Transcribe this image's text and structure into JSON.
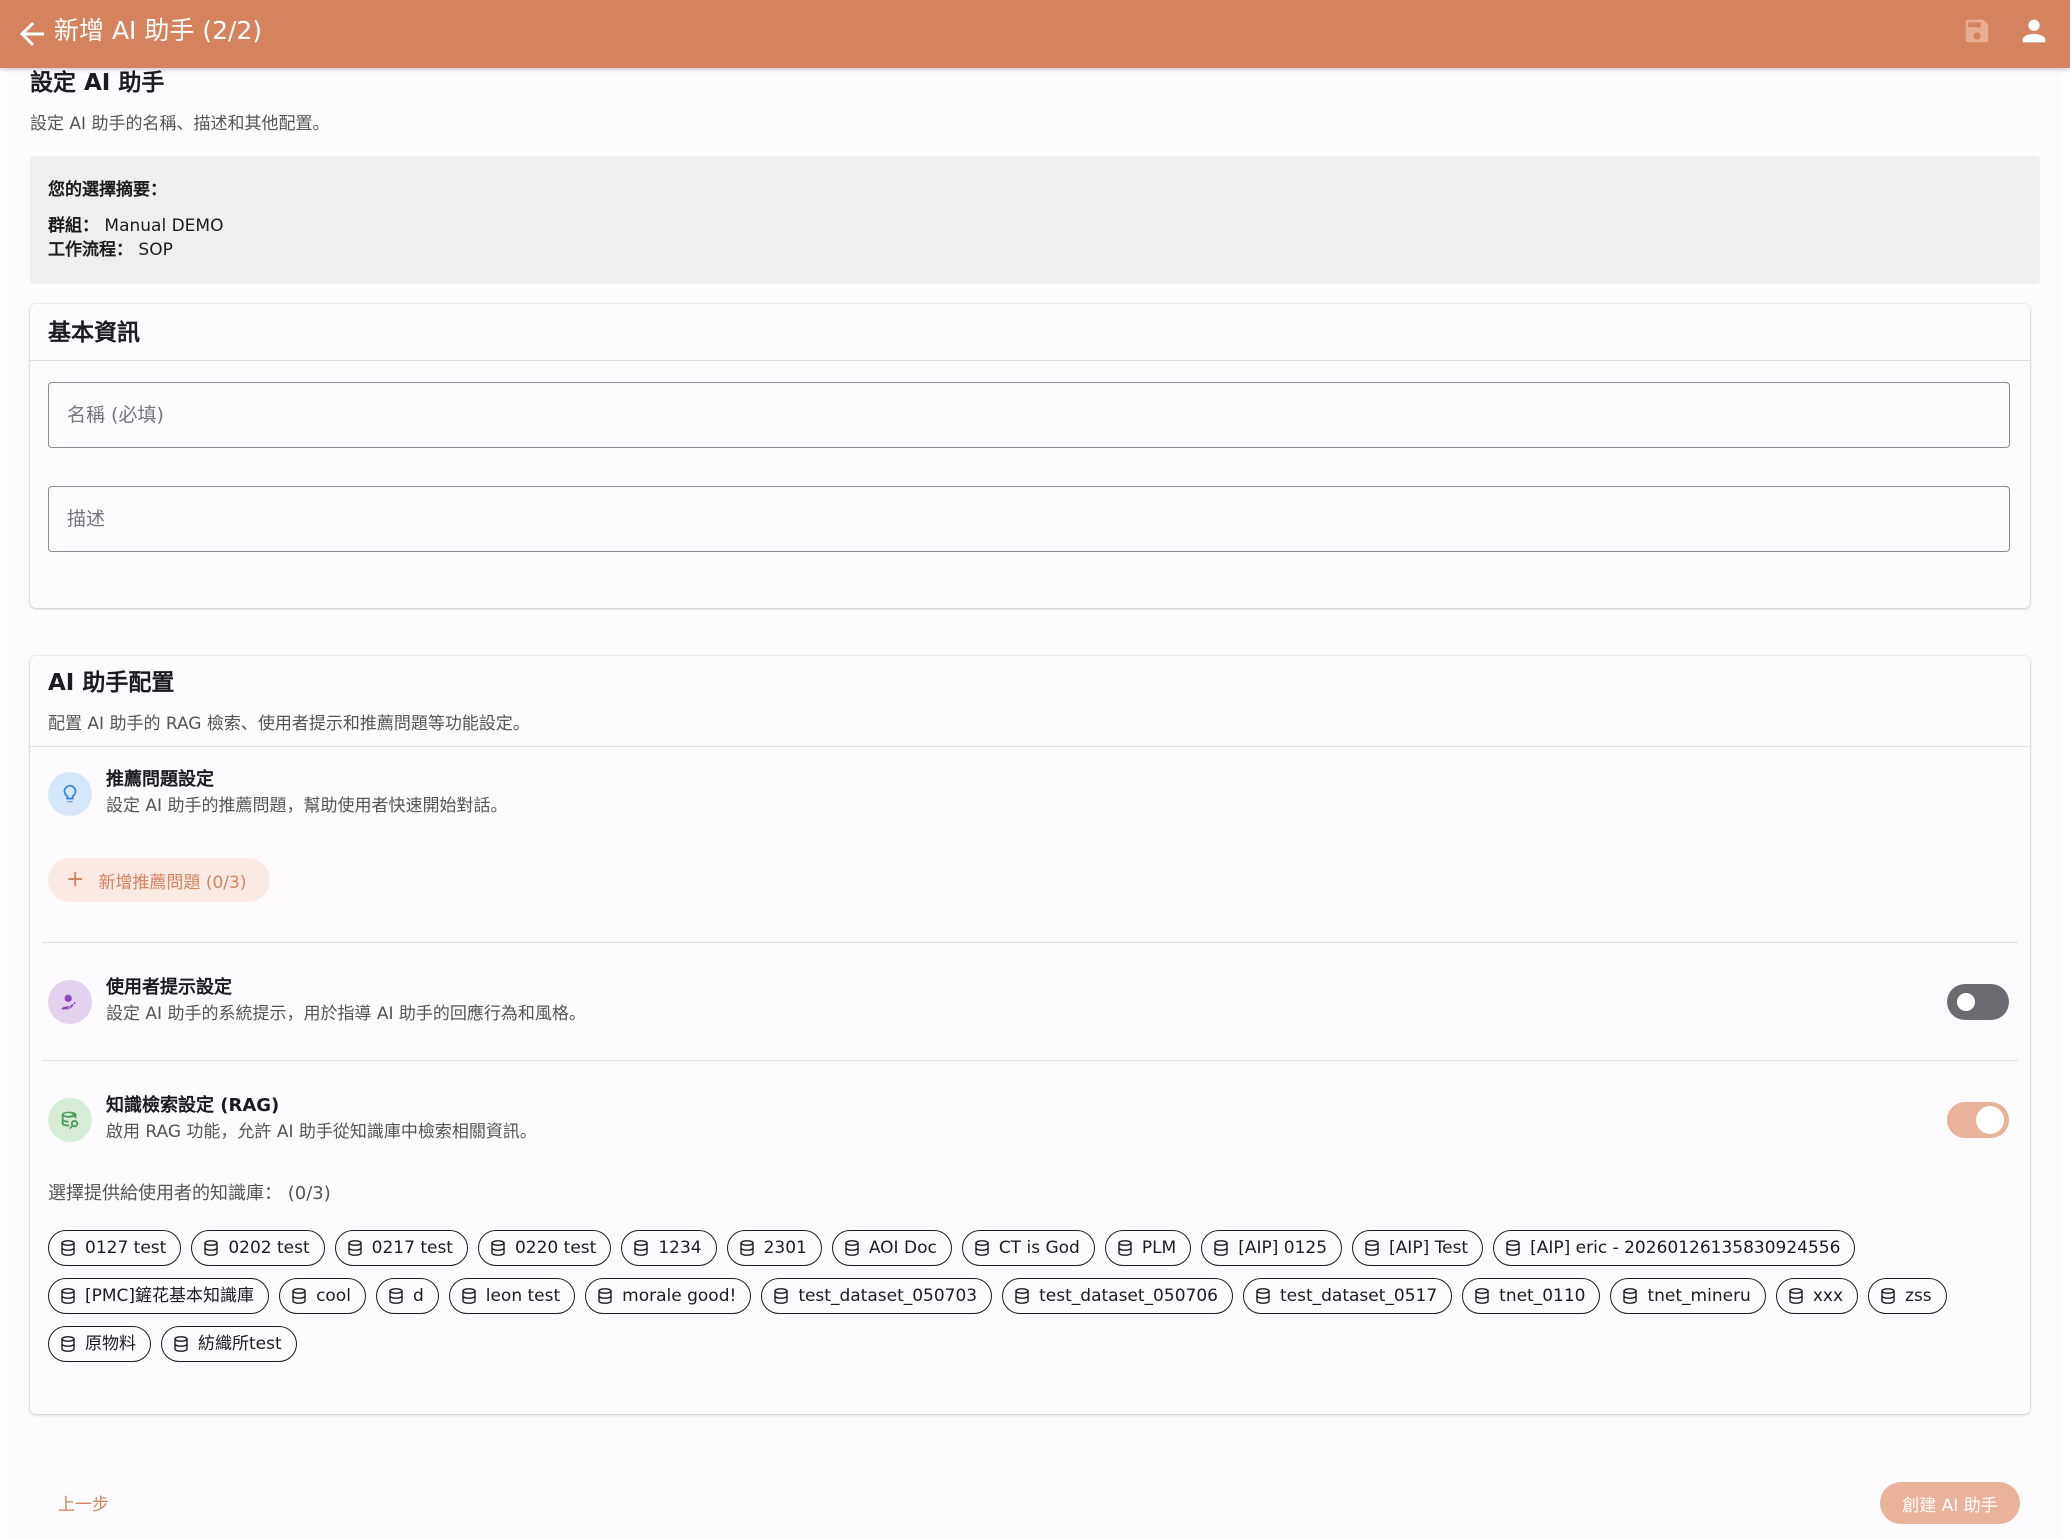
{
  "appbar": {
    "title": "新增 AI 助手 (2/2)",
    "back_icon": "arrow-left-icon",
    "save_icon": "save-icon",
    "account_icon": "account-icon",
    "color": "#d4835e"
  },
  "page": {
    "title": "設定 AI 助手",
    "description": "設定 AI 助手的名稱、描述和其他配置。"
  },
  "summary": {
    "heading": "您的選擇摘要：",
    "group_label": "群組：",
    "group_value": "Manual DEMO",
    "workflow_label": "工作流程：",
    "workflow_value": "SOP"
  },
  "basic_info": {
    "title": "基本資訊",
    "name_placeholder": "名稱 (必填)",
    "desc_placeholder": "描述"
  },
  "config": {
    "title": "AI 助手配置",
    "description": "配置 AI 助手的 RAG 檢索、使用者提示和推薦問題等功能設定。",
    "suggested": {
      "icon": "lightbulb-icon",
      "title": "推薦問題設定",
      "description": "設定 AI 助手的推薦問題，幫助使用者快速開始對話。",
      "add_button": "新增推薦問題 (0/3)"
    },
    "user_prompt": {
      "icon": "person-edit-icon",
      "title": "使用者提示設定",
      "description": "設定 AI 助手的系統提示，用於指導 AI 助手的回應行為和風格。",
      "enabled": false
    },
    "rag": {
      "icon": "database-search-icon",
      "title": "知識檢索設定 (RAG)",
      "description": "啟用 RAG 功能，允許 AI 助手從知識庫中檢索相關資訊。",
      "enabled": true,
      "kb_label": "選擇提供給使用者的知識庫： (0/3)",
      "knowledge_bases": [
        "0127 test",
        "0202 test",
        "0217 test",
        "0220 test",
        "1234",
        "2301",
        "AOI Doc",
        "CT is God",
        "PLM",
        "[AIP] 0125",
        "[AIP] Test",
        "[AIP] eric - 20260126135830924556",
        "[PMC]鏟花基本知識庫",
        "cool",
        "d",
        "leon test",
        "morale good!",
        "test_dataset_050703",
        "test_dataset_050706",
        "test_dataset_0517",
        "tnet_0110",
        "tnet_mineru",
        "xxx",
        "zss",
        "原物料",
        "紡織所test"
      ]
    }
  },
  "footer": {
    "prev_button": "上一步",
    "create_button": "創建 AI 助手"
  }
}
